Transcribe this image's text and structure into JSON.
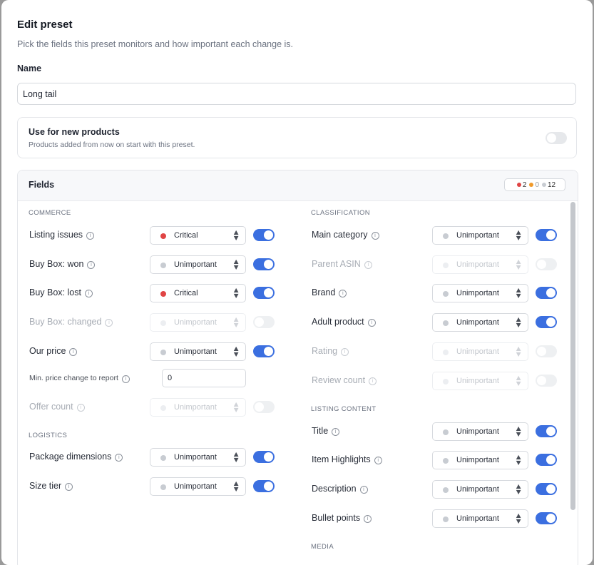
{
  "dialog": {
    "title": "Edit preset",
    "subtitle": "Pick the fields this preset monitors and how important each change is.",
    "name_label": "Name",
    "name_value": "Long tail"
  },
  "new_products": {
    "title": "Use for new products",
    "description": "Products added from now on start with this preset.",
    "enabled": false
  },
  "fields_panel": {
    "title": "Fields",
    "counts": {
      "critical": "2",
      "important": "0",
      "unimportant": "12"
    },
    "colors": {
      "critical": "#e04444",
      "important": "#f09a2a",
      "unimportant": "#c8ccd2",
      "accent": "#3b6fe0"
    }
  },
  "left": {
    "commerce_heading": "COMMERCE",
    "logistics_heading": "LOGISTICS",
    "rows": [
      {
        "label": "Listing issues",
        "severity": "Critical",
        "enabled": true
      },
      {
        "label": "Buy Box: won",
        "severity": "Unimportant",
        "enabled": true
      },
      {
        "label": "Buy Box: lost",
        "severity": "Critical",
        "enabled": true
      },
      {
        "label": "Buy Box: changed",
        "severity": "Unimportant",
        "enabled": false
      },
      {
        "label": "Our price",
        "severity": "Unimportant",
        "enabled": true
      },
      {
        "label": "Offer count",
        "severity": "Unimportant",
        "enabled": false
      },
      {
        "label": "Package dimensions",
        "severity": "Unimportant",
        "enabled": true
      },
      {
        "label": "Size tier",
        "severity": "Unimportant",
        "enabled": true
      }
    ],
    "min_price": {
      "label": "Min. price change to report",
      "value": "0"
    }
  },
  "right": {
    "classification_heading": "CLASSIFICATION",
    "listing_content_heading": "LISTING CONTENT",
    "media_heading": "MEDIA",
    "rows": [
      {
        "label": "Main category",
        "severity": "Unimportant",
        "enabled": true
      },
      {
        "label": "Parent ASIN",
        "severity": "Unimportant",
        "enabled": false
      },
      {
        "label": "Brand",
        "severity": "Unimportant",
        "enabled": true
      },
      {
        "label": "Adult product",
        "severity": "Unimportant",
        "enabled": true
      },
      {
        "label": "Rating",
        "severity": "Unimportant",
        "enabled": false
      },
      {
        "label": "Review count",
        "severity": "Unimportant",
        "enabled": false
      },
      {
        "label": "Title",
        "severity": "Unimportant",
        "enabled": true
      },
      {
        "label": "Item Highlights",
        "severity": "Unimportant",
        "enabled": true
      },
      {
        "label": "Description",
        "severity": "Unimportant",
        "enabled": true
      },
      {
        "label": "Bullet points",
        "severity": "Unimportant",
        "enabled": true
      }
    ]
  }
}
